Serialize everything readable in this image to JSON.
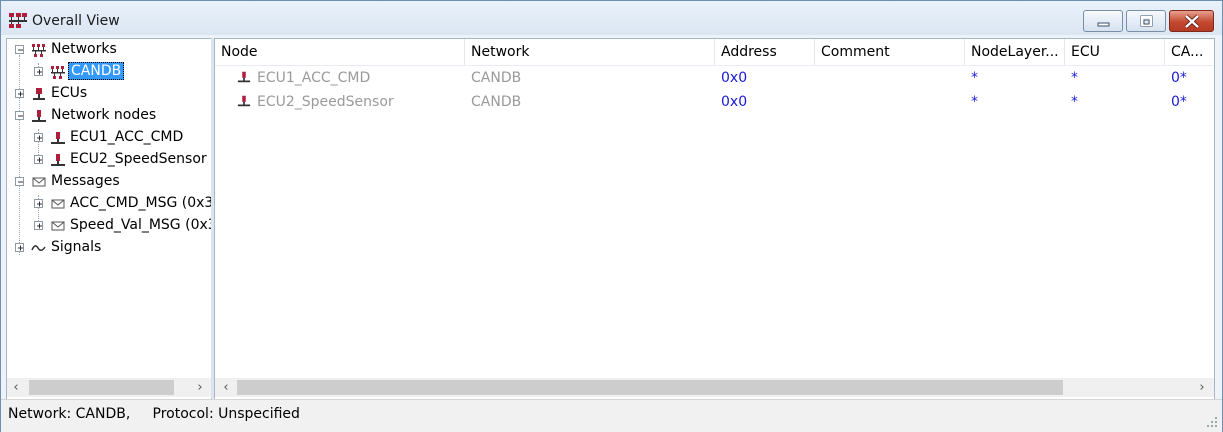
{
  "window": {
    "title": "Overall View"
  },
  "tree": {
    "items": [
      {
        "label": "Networks",
        "icon": "network-icon",
        "selected": false
      },
      {
        "label": "CANDB",
        "icon": "network-icon",
        "selected": true
      },
      {
        "label": "ECUs",
        "icon": "ecu-icon",
        "selected": false
      },
      {
        "label": "Network nodes",
        "icon": "node-icon",
        "selected": false
      },
      {
        "label": "ECU1_ACC_CMD",
        "icon": "node-icon",
        "selected": false
      },
      {
        "label": "ECU2_SpeedSensor",
        "icon": "node-icon",
        "selected": false
      },
      {
        "label": "Messages",
        "icon": "message-icon",
        "selected": false
      },
      {
        "label": "ACC_CMD_MSG (0x30",
        "icon": "message-icon",
        "selected": false
      },
      {
        "label": "Speed_Val_MSG (0x3",
        "icon": "message-icon",
        "selected": false
      },
      {
        "label": "Signals",
        "icon": "signal-icon",
        "selected": false
      }
    ]
  },
  "table": {
    "columns": [
      "Node",
      "Network",
      "Address",
      "Comment",
      "NodeLayer...",
      "ECU",
      "CA..."
    ],
    "rows": [
      [
        "ECU1_ACC_CMD",
        "CANDB",
        "0x0",
        "",
        "*",
        "*",
        "0*"
      ],
      [
        "ECU2_SpeedSensor",
        "CANDB",
        "0x0",
        "",
        "*",
        "*",
        "0*"
      ]
    ]
  },
  "status": {
    "text": "Network: CANDB,     Protocol: Unspecified"
  },
  "colors": {
    "selection": "#3399ff",
    "value_blue": "#1a1ad6",
    "dimmed_text": "#9a9a9a",
    "node_icon": "#b01e3c"
  }
}
